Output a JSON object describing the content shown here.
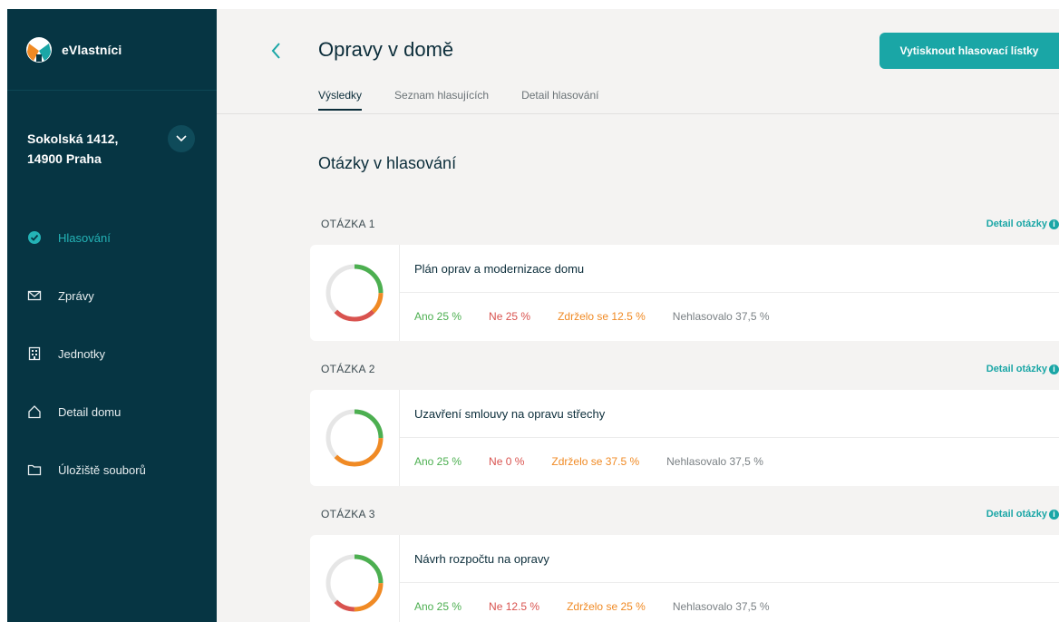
{
  "brand": {
    "name": "eVlastníci"
  },
  "building": {
    "address_line1": "Sokolská 1412,",
    "address_line2": "14900 Praha"
  },
  "nav": {
    "items": [
      {
        "label": "Hlasování",
        "icon": "check-circle-icon",
        "active": true
      },
      {
        "label": "Zprávy",
        "icon": "envelope-icon"
      },
      {
        "label": "Jednotky",
        "icon": "building-icon"
      },
      {
        "label": "Detail domu",
        "icon": "house-icon"
      },
      {
        "label": "Úložiště souborů",
        "icon": "folder-icon"
      }
    ]
  },
  "header": {
    "title": "Opravy v domě",
    "print_label": "Vytisknout hlasovací lístky"
  },
  "tabs": [
    {
      "label": "Výsledky",
      "active": true
    },
    {
      "label": "Seznam hlasujících"
    },
    {
      "label": "Detail hlasování"
    }
  ],
  "section_title": "Otázky v hlasování",
  "questions": [
    {
      "label": "OTÁZKA 1",
      "detail_label": "Detail otázky",
      "title": "Plán oprav a modernizace domu",
      "stats": {
        "yes": "Ano 25 %",
        "no": "Ne 25 %",
        "abstain": "Zdrželo se 12.5 %",
        "none": "Nehlasovalo 37,5 %"
      },
      "chart": {
        "yes": 25,
        "no": 25,
        "abstain": 12.5,
        "none": 37.5
      }
    },
    {
      "label": "OTÁZKA 2",
      "detail_label": "Detail otázky",
      "title": "Uzavření smlouvy na opravu střechy",
      "stats": {
        "yes": "Ano 25 %",
        "no": "Ne 0 %",
        "abstain": "Zdrželo se 37.5 %",
        "none": "Nehlasovalo 37,5 %"
      },
      "chart": {
        "yes": 25,
        "no": 0,
        "abstain": 37.5,
        "none": 37.5
      }
    },
    {
      "label": "OTÁZKA 3",
      "detail_label": "Detail otázky",
      "title": "Návrh rozpočtu na opravy",
      "stats": {
        "yes": "Ano 25 %",
        "no": "Ne 12.5 %",
        "abstain": "Zdrželo se 25 %",
        "none": "Nehlasovalo 37,5 %"
      },
      "chart": {
        "yes": 25,
        "no": 12.5,
        "abstain": 25,
        "none": 37.5
      }
    }
  ],
  "colors": {
    "yes": "#4caf50",
    "no": "#d9534f",
    "abstain": "#f08a24",
    "none": "#e6e6e6",
    "accent": "#1aa6a6",
    "sidebar": "#063543"
  }
}
